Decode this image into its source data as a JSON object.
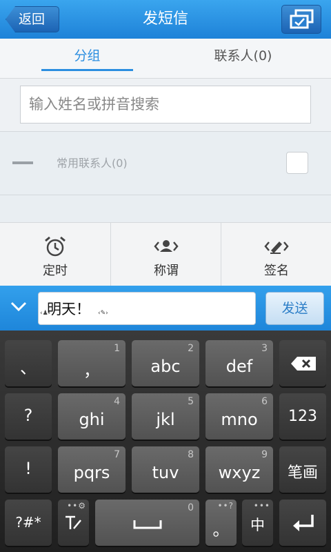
{
  "header": {
    "back_label": "返回",
    "title": "发短信",
    "corner_icon": "multi-window-icon"
  },
  "tabs": [
    {
      "label": "分组",
      "active": true
    },
    {
      "label": "联系人(0)",
      "active": false
    }
  ],
  "search": {
    "placeholder": "输入姓名或拼音搜索"
  },
  "list": {
    "frequent_label": "常用联系人(0)"
  },
  "tools": [
    {
      "label": "定时",
      "icon": "alarm-clock-icon"
    },
    {
      "label": "称谓",
      "icon": "person-tag-icon"
    },
    {
      "label": "签名",
      "icon": "signature-tag-icon"
    }
  ],
  "compose": {
    "message": "明天！",
    "send_label": "发送"
  },
  "keyboard": {
    "row1": [
      {
        "main": "、"
      },
      {
        "main": "，",
        "num": "1"
      },
      {
        "main": "abc",
        "num": "2"
      },
      {
        "main": "def",
        "num": "3"
      }
    ],
    "row2": [
      {
        "main": "?"
      },
      {
        "main": "ghi",
        "num": "4"
      },
      {
        "main": "jkl",
        "num": "5"
      },
      {
        "main": "mno",
        "num": "6"
      },
      {
        "main": "123"
      }
    ],
    "row3": [
      {
        "main": "!"
      },
      {
        "main": "pqrs",
        "num": "7"
      },
      {
        "main": "tuv",
        "num": "8"
      },
      {
        "main": "wxyz",
        "num": "9"
      },
      {
        "main": "笔画"
      }
    ],
    "row4": {
      "symbols": "?#*",
      "space_num": "0",
      "period": "。",
      "chinese": "中"
    }
  }
}
